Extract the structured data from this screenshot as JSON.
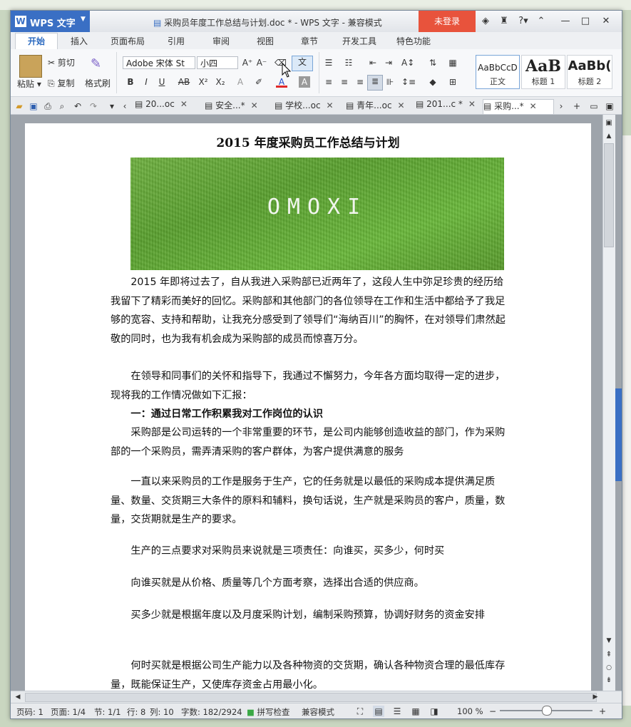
{
  "app": {
    "name": "WPS 文字",
    "logo": "W"
  },
  "window": {
    "title": "采购员年度工作总结与计划.doc * - WPS 文字 - 兼容模式",
    "login_label": "未登录"
  },
  "menus": [
    "开始",
    "插入",
    "页面布局",
    "引用",
    "审阅",
    "视图",
    "章节",
    "开发工具",
    "特色功能"
  ],
  "ribbon": {
    "paste": "粘贴",
    "cut": "剪切",
    "copy": "复制",
    "format_painter": "格式刷",
    "font_name": "Adobe 宋体 St",
    "font_size": "小四",
    "styles": [
      {
        "preview": "AaBbCcD",
        "name": "正文"
      },
      {
        "preview": "AaB",
        "name": "标题 1"
      },
      {
        "preview": "AaBb(",
        "name": "标题 2"
      }
    ]
  },
  "doc_tabs": [
    {
      "label": "20...oc"
    },
    {
      "label": "安全...*"
    },
    {
      "label": "学校...oc"
    },
    {
      "label": "青年...oc"
    },
    {
      "label": "201...c *"
    },
    {
      "label": "采购...*"
    }
  ],
  "document": {
    "title": "2015 年度采购员工作总结与计划",
    "image_text": "OMOXI",
    "paragraphs": [
      "　　2015 年即将过去了，自从我进入采购部已近两年了，这段人生中弥足珍贵的经历给我留下了精彩而美好的回忆。采购部和其他部门的各位领导在工作和生活中都给予了我足够的宽容、支持和帮助，让我充分感受到了领导们“海纳百川”的胸怀，在对领导们肃然起敬的同时，也为我有机会成为采购部的成员而惊喜万分。",
      "　　在领导和同事们的关怀和指导下，我通过不懈努力，今年各方面均取得一定的进步，现将我的工作情况做如下汇报：",
      "　　一：通过日常工作积累我对工作岗位的认识",
      "　　采购部是公司运转的一个非常重要的环节，是公司内能够创造收益的部门，作为采购部的一个采购员，需弄清采购的客户群体，为客户提供满意的服务",
      "　　一直以来采购员的工作是服务于生产，它的任务就是以最低的采购成本提供满足质量、数量、交货期三大条件的原料和辅料，换句话说，生产就是采购员的客户，质量，数量，交货期就是生产的要求。",
      "　　生产的三点要求对采购员来说就是三项责任：向谁买，买多少，何时买",
      "　　向谁买就是从价格、质量等几个方面考察，选择出合适的供应商。",
      "　　买多少就是根据年度以及月度采购计划，编制采购预算，协调好财务的资金安排",
      "　　何时买就是根据公司生产能力以及各种物资的交货期，确认各种物资合理的最低库存量，既能保证生产，又使库存资金占用最小化。"
    ]
  },
  "status": {
    "page_code": "页码: 1",
    "pages": "页面: 1/4",
    "section": "节: 1/1",
    "row": "行: 8",
    "col": "列: 10",
    "words": "字数: 182/2924",
    "spell": "拼写检查",
    "mode": "兼容模式",
    "zoom": "100 %",
    "zoom_level": 1.0
  },
  "colors": {
    "accent": "#3a6fc4",
    "login": "#e8533c"
  }
}
